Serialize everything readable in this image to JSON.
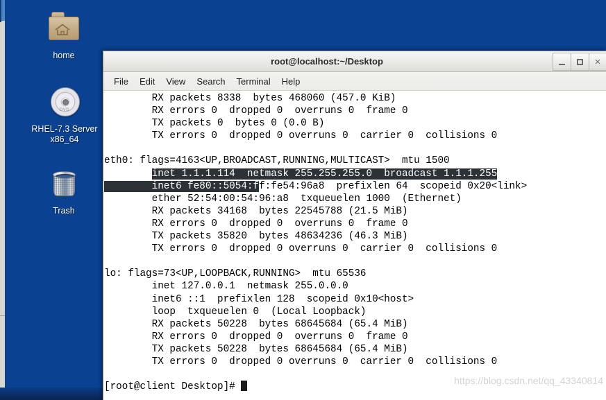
{
  "desktop": {
    "background_color": "#0a4291",
    "icons": [
      {
        "name": "home",
        "label": "home",
        "icon": "folder-home-icon"
      },
      {
        "name": "rhel-dvd",
        "label_line1": "RHEL-7.3 Server",
        "label_line2": "x86_64",
        "icon": "dvd-disc-icon",
        "disc_text": "DVD"
      },
      {
        "name": "trash",
        "label": "Trash",
        "icon": "trash-bin-icon"
      }
    ]
  },
  "window": {
    "title": "root@localhost:~/Desktop",
    "buttons": {
      "minimize": "_",
      "maximize": "□",
      "close": "×"
    },
    "menu": [
      "File",
      "Edit",
      "View",
      "Search",
      "Terminal",
      "Help"
    ]
  },
  "terminal": {
    "prompt": "[root@client Desktop]#",
    "cursor": "block",
    "selection_color": "#2d3237",
    "lines": [
      "        RX packets 8338  bytes 468060 (457.0 KiB)",
      "        RX errors 0  dropped 0  overruns 0  frame 0",
      "        TX packets 0  bytes 0 (0.0 B)",
      "        TX errors 0  dropped 0 overruns 0  carrier 0  collisions 0",
      "",
      "eth0: flags=4163<UP,BROADCAST,RUNNING,MULTICAST>  mtu 1500",
      "        inet 1.1.1.114  netmask 255.255.255.0  broadcast 1.1.1.255",
      "        inet6 fe80::5054:ff:fe54:96a8  prefixlen 64  scopeid 0x20<link>",
      "        ether 52:54:00:54:96:a8  txqueuelen 1000  (Ethernet)",
      "        RX packets 34168  bytes 22545788 (21.5 MiB)",
      "        RX errors 0  dropped 0  overruns 0  frame 0",
      "        TX packets 35820  bytes 48634236 (46.3 MiB)",
      "        TX errors 0  dropped 0 overruns 0  carrier 0  collisions 0",
      "",
      "lo: flags=73<UP,LOOPBACK,RUNNING>  mtu 65536",
      "        inet 127.0.0.1  netmask 255.0.0.0",
      "        inet6 ::1  prefixlen 128  scopeid 0x10<host>",
      "        loop  txqueuelen 0  (Local Loopback)",
      "        RX packets 50228  bytes 68645684 (65.4 MiB)",
      "        RX errors 0  dropped 0  overruns 0  frame 0",
      "        TX packets 50228  bytes 68645684 (65.4 MiB)",
      "        TX errors 0  dropped 0 overruns 0  carrier 0  collisions 0",
      ""
    ],
    "selected_line_inet": {
      "lead": "        ",
      "text": "inet 1.1.1.114  netmask 255.255.255.0  broadcast 1.1.1.255"
    },
    "selected_line_inet6": {
      "highlighted": "        inet6 fe80::5054:f",
      "plain": "f:fe54:96a8  prefixlen 64  scopeid 0x20<link>"
    }
  },
  "watermark": {
    "text": "https://blog.csdn.net/qq_43340814"
  }
}
